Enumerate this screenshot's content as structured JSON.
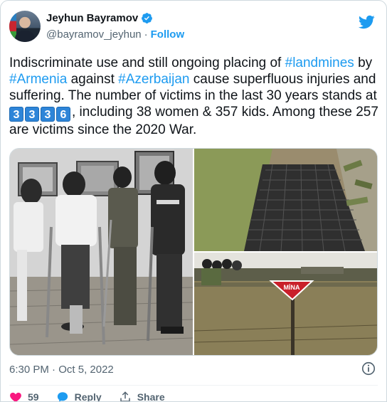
{
  "author": {
    "name": "Jeyhun Bayramov",
    "handle": "@bayramov_jeyhun",
    "separator": "·",
    "follow_label": "Follow"
  },
  "tweet": {
    "t1": "Indiscriminate use and still ongoing placing of ",
    "tag_landmines": "#landmines",
    "t2": " by ",
    "tag_armenia": "#Armenia",
    "t3": " against ",
    "tag_azerbaijan": "#Azerbaijan",
    "t4": " cause superfluous injuries and suffering. The number of victims in the last 30 years stands at ",
    "keycaps": [
      "3",
      "3",
      "3",
      "6"
    ],
    "t5": ", including 38 women & 357 kids. Among these 257 are victims since the 2020 War."
  },
  "media": {
    "sign_text": "MİNA"
  },
  "meta": {
    "time": "6:30 PM",
    "separator": "·",
    "date": "Oct 5, 2022"
  },
  "actions": {
    "like_count": "59",
    "reply_label": "Reply",
    "share_label": "Share"
  },
  "colors": {
    "accent": "#1d9bf0",
    "like": "#f91880",
    "text": "#0f1419",
    "muted": "#536471"
  }
}
